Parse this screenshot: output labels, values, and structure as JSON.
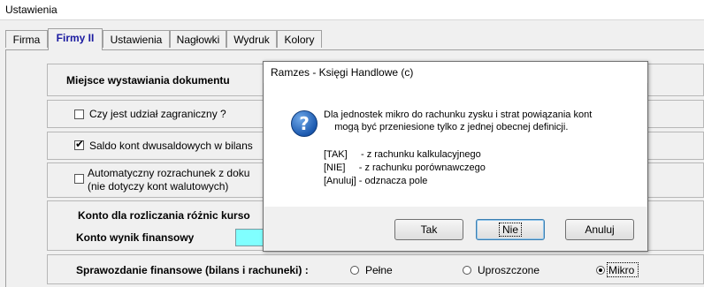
{
  "window": {
    "title": "Ustawienia"
  },
  "tabs": [
    {
      "label": "Firma"
    },
    {
      "label": "Firmy II",
      "active": true
    },
    {
      "label": "Ustawienia"
    },
    {
      "label": "Nagłowki"
    },
    {
      "label": "Wydruk"
    },
    {
      "label": "Kolory"
    }
  ],
  "settings": {
    "place_header": "Miejsce wystawiania dokumentu",
    "foreign_share_label": "Czy jest udział zagraniczny ?",
    "foreign_share_checked": false,
    "dual_balance_label": "Saldo kont dwusaldowych w bilans",
    "dual_balance_checked": true,
    "auto_settlement_line1": "Automatyczny rozrachunek z doku",
    "auto_settlement_line2": "(nie dotyczy kont walutowych)",
    "auto_settlement_checked": false,
    "fx_account_label": "Konto dla rozliczania różnic kurso",
    "result_account_label": "Konto wynik finansowy",
    "result_account_value": "",
    "report_label": "Sprawozdanie finansowe (bilans i rachuneki) :",
    "report_options": [
      {
        "label": "Pełne",
        "selected": false
      },
      {
        "label": "Uproszczone",
        "selected": false
      },
      {
        "label": "Mikro",
        "selected": true
      }
    ]
  },
  "dialog": {
    "title": "Ramzes - Księgi Handlowe (c)",
    "icon": "question-icon",
    "message_line1": "Dla jednostek mikro do rachunku zysku i strat powiązania kont",
    "message_line2": "    mogą być przeniesione tylko z jednej obecnej definicji.",
    "option_tak": "[TAK]     - z rachunku kalkulacyjnego",
    "option_nie": "[NIE]     - z rachunku porównawczego",
    "option_anuluj": "[Anuluj] - odznacza pole",
    "buttons": {
      "yes": "Tak",
      "no": "Nie",
      "cancel": "Anuluj"
    }
  },
  "colors": {
    "active_tab_text": "#1a1aa0",
    "account_field_bg": "#80ffff"
  }
}
